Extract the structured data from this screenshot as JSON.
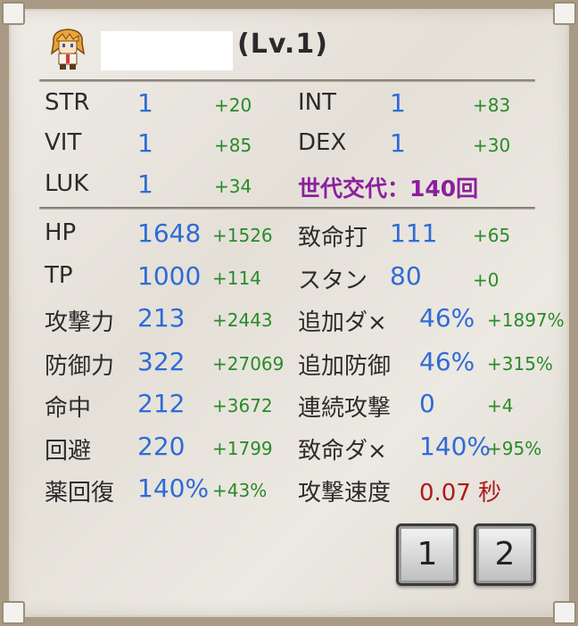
{
  "header": {
    "level": "(Lv.1)"
  },
  "base_stats": [
    {
      "label": "STR",
      "value": "1",
      "bonus": "+20"
    },
    {
      "label": "INT",
      "value": "1",
      "bonus": "+83"
    },
    {
      "label": "VIT",
      "value": "1",
      "bonus": "+85"
    },
    {
      "label": "DEX",
      "value": "1",
      "bonus": "+30"
    },
    {
      "label": "LUK",
      "value": "1",
      "bonus": "+34"
    }
  ],
  "generation": "世代交代：140回",
  "combat_stats": [
    {
      "label": "HP",
      "value": "1648",
      "bonus": "+1526"
    },
    {
      "label": "致命打",
      "value": "111",
      "bonus": "+65"
    },
    {
      "label": "TP",
      "value": "1000",
      "bonus": "+114"
    },
    {
      "label": "スタン",
      "value": "80",
      "bonus": "+0"
    },
    {
      "label": "攻撃力",
      "value": "213",
      "bonus": "+2443"
    },
    {
      "label": "追加ダ×",
      "value": "46%",
      "bonus": "+1897%"
    },
    {
      "label": "防御力",
      "value": "322",
      "bonus": "+27069"
    },
    {
      "label": "追加防御",
      "value": "46%",
      "bonus": "+315%"
    },
    {
      "label": "命中",
      "value": "212",
      "bonus": "+3672"
    },
    {
      "label": "連続攻撃",
      "value": "0",
      "bonus": "+4"
    },
    {
      "label": "回避",
      "value": "220",
      "bonus": "+1799"
    },
    {
      "label": "致命ダ×",
      "value": "140%",
      "bonus": "+95%"
    },
    {
      "label": "薬回復",
      "value": "140%",
      "bonus": "+43%"
    },
    {
      "label": "攻撃速度",
      "value": "0.07 秒",
      "bonus": ""
    }
  ],
  "pages": [
    "1",
    "2"
  ],
  "colors": {
    "value": "#2f6bd6",
    "bonus": "#2a8a2a",
    "generation": "#8c1f9c",
    "speed": "#b01818"
  }
}
